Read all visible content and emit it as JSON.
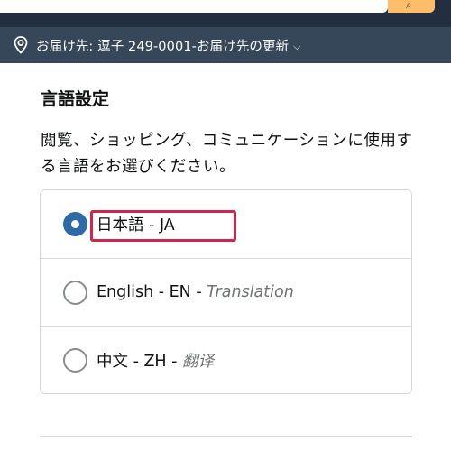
{
  "header": {
    "search_icon": "search-icon",
    "deliver_label": "お届け先: 逗子 249-0001-お届け先の更新",
    "caret": "⌵"
  },
  "language_settings": {
    "title": "言語設定",
    "description": "閲覧、ショッピング、コミュニケーションに使用する言語をお選びください。",
    "options": [
      {
        "label": "日本語 - JA",
        "translation": "",
        "selected": true
      },
      {
        "label": "English - EN - ",
        "translation": "Translation",
        "selected": false
      },
      {
        "label": "中文 - ZH - ",
        "translation": "翻译",
        "selected": false
      }
    ]
  },
  "colors": {
    "header_dark": "#232f3e",
    "deliver_bar": "#37475a",
    "search_button": "#febd69",
    "radio_selected": "#2e6aa5",
    "highlight": "#d0254c"
  }
}
